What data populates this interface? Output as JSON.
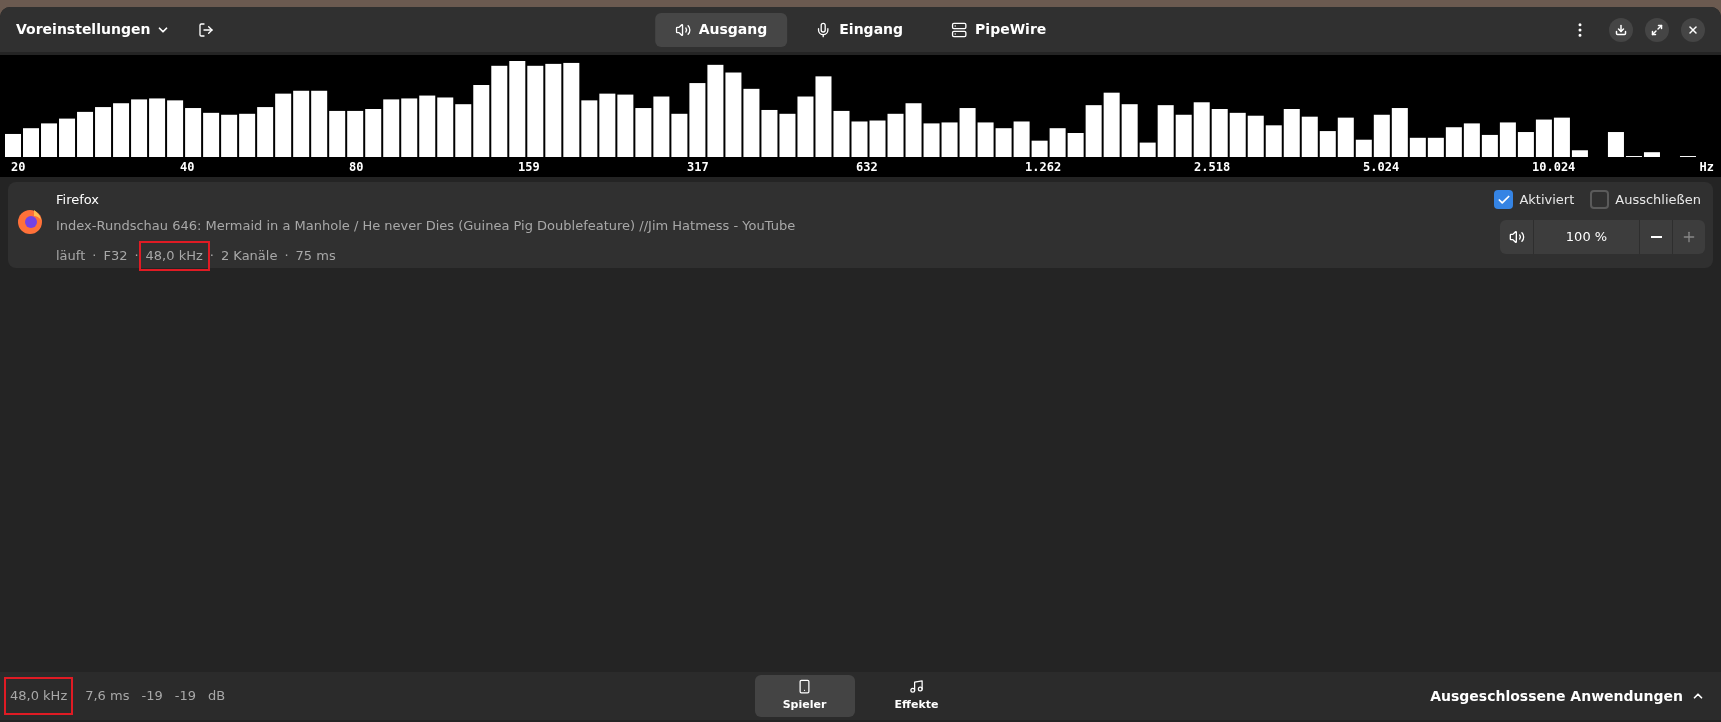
{
  "header": {
    "presets_label": "Voreinstellungen",
    "tabs": [
      {
        "label": "Ausgang",
        "kind": "speaker",
        "selected": true
      },
      {
        "label": "Eingang",
        "kind": "mic",
        "selected": false
      },
      {
        "label": "PipeWire",
        "kind": "server",
        "selected": false
      }
    ]
  },
  "spectrum": {
    "labels": [
      "20",
      "40",
      "80",
      "159",
      "317",
      "632",
      "1.262",
      "2.518",
      "5.024",
      "10.024"
    ],
    "unit": "Hz"
  },
  "apps": [
    {
      "name": "Firefox",
      "title": "Index-Rundschau 646: Mermaid in a Manhole / He never Dies (Guinea Pig Doublefeature) //Jim Hatmess - YouTube",
      "separator": "·",
      "meta": [
        {
          "text": "läuft",
          "highlighted": false
        },
        {
          "text": "F32",
          "highlighted": false
        },
        {
          "text": "48,0 kHz",
          "highlighted": true
        },
        {
          "text": "2 Kanäle",
          "highlighted": false
        },
        {
          "text": "75 ms",
          "highlighted": false
        }
      ],
      "enabled": {
        "label": "Aktiviert",
        "checked": true
      },
      "exclude": {
        "label": "Ausschließen",
        "checked": false
      },
      "volume": "100 %"
    }
  ],
  "status_bar": {
    "stats": [
      {
        "text": "48,0 kHz",
        "highlighted": true
      },
      {
        "text": "7,6 ms",
        "highlighted": false
      },
      {
        "text": "-19",
        "highlighted": false
      },
      {
        "text": "-19",
        "highlighted": false
      },
      {
        "text": "dB",
        "highlighted": false
      }
    ],
    "tabs": [
      {
        "label": "Spieler",
        "kind": "player",
        "selected": true
      },
      {
        "label": "Effekte",
        "kind": "effects",
        "selected": false
      }
    ],
    "excluded_label": "Ausgeschlossene Anwendungen"
  }
}
